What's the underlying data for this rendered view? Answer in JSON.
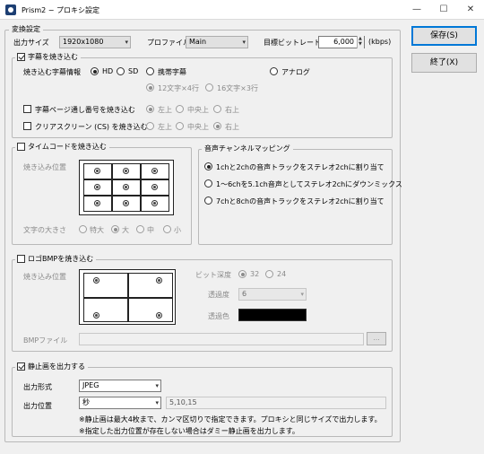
{
  "window": {
    "title": "Prism2 − プロキシ設定",
    "minimize": "—",
    "maximize": "☐",
    "close": "✕"
  },
  "buttons": {
    "save": "保存(S)",
    "exit": "終了(X)"
  },
  "conversion": {
    "group_label": "変換設定",
    "output_size_label": "出力サイズ",
    "output_size_value": "1920x1080",
    "profile_label": "プロファイル",
    "profile_value": "Main",
    "bitrate_label": "目標ビットレート",
    "bitrate_value": "6,000",
    "bitrate_unit": "(kbps)"
  },
  "subtitle": {
    "group_label": "字幕を焼き込む",
    "info_label": "焼き込む字幕情報",
    "types": [
      "HD",
      "SD",
      "携帯字幕",
      "アナログ"
    ],
    "selected_type": "HD",
    "layouts": [
      "12文字×4行",
      "16文字×3行"
    ],
    "page_number_label": "字幕ページ通し番号を焼き込む",
    "clear_screen_label": "クリアスクリーン (CS) を焼き込む",
    "positions": [
      "左上",
      "中央上",
      "右上"
    ]
  },
  "timecode": {
    "group_label": "タイムコードを焼き込む",
    "position_label": "焼き込み位置",
    "size_label": "文字の大きさ",
    "sizes": [
      "特大",
      "大",
      "中",
      "小"
    ],
    "selected_size": "大"
  },
  "audio": {
    "group_label": "音声チャンネルマッピング",
    "options": [
      "1chと2chの音声トラックをステレオ2chに割り当て",
      "1〜6chを5.1ch音声としてステレオ2chにダウンミックス",
      "7chと8chの音声トラックをステレオ2chに割り当て"
    ],
    "selected_index": 0
  },
  "logo": {
    "group_label": "ロゴBMPを焼き込む",
    "position_label": "焼き込み位置",
    "bit_depth_label": "ビット深度",
    "bit_depths": [
      "32",
      "24"
    ],
    "selected_bit_depth": "32",
    "transparency_label": "透過度",
    "transparency_value": "6",
    "transparent_color_label": "透過色",
    "transparent_color": "#000000",
    "file_label": "BMPファイル",
    "file_value": "",
    "browse_label": "..."
  },
  "still": {
    "group_label": "静止画を出力する",
    "format_label": "出力形式",
    "format_value": "JPEG",
    "position_label": "出力位置",
    "position_unit": "秒",
    "position_value": "5,10,15",
    "note1": "※静止画は最大4枚まで、カンマ区切りで指定できます。プロキシと同じサイズで出力します。",
    "note2": "※指定した出力位置が存在しない場合はダミー静止画を出力します。"
  },
  "checkboxes": {
    "subtitle": true,
    "page_number": false,
    "clear_screen": false,
    "timecode": false,
    "logo": false,
    "still": true
  },
  "colors": {
    "window_bg": "#f0f0f0",
    "accent_border": "#0078d7",
    "frame_border": "#b9b9b9"
  },
  "icons": {
    "app": "prism-app-icon",
    "dropdown": "chevron-down-icon",
    "spin": "spin-arrows-icon"
  }
}
